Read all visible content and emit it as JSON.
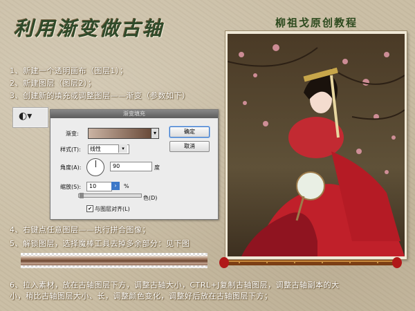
{
  "header": {
    "title": "利用渐变做古轴",
    "subtitle": "柳祖戈原创教程"
  },
  "steps": {
    "s1": "1、新建一个透明画布（图层1）；",
    "s2": "2、新建图层（图层2）；",
    "s3": "3、创建新的填充或调整图层——渐变（参数如下）",
    "s4": "4、右键点任意图层——执行拼合图像；",
    "s5": "5、解锁图层，选择魔棒工具去掉多余部分：见下图",
    "s6a": "6、拉入素材，放在古轴图层下方，调整古轴大小，CTRL+J复制古轴图层，调整古轴副本的大",
    "s6b": "小，稍比古轴图层大小、长，调整颜色变化，调整好后放在古轴图层下方；"
  },
  "dialog": {
    "title": "渐变填充",
    "gradient_label": "渐变:",
    "style_label": "样式(T):",
    "style_value": "线性",
    "angle_label": "角度(A):",
    "angle_value": "90",
    "angle_unit": "度",
    "scale_label": "缩放(S):",
    "scale_value": "10",
    "scale_unit": "%",
    "align_label": "与图层对齐(L)",
    "ok_label": "确定",
    "cancel_label": "取消",
    "dither_fragment": "色(D)",
    "gradient_colors": [
      "#cbb4a4",
      "#6a4b3a"
    ]
  },
  "icons": {
    "fill_adjust": "adjustment-layer-icon"
  },
  "colors": {
    "title_green": "#2f4a2a",
    "step_text": "#ffffff",
    "scroll_wood": "#7a3e14",
    "scroll_cap": "#b01818"
  }
}
